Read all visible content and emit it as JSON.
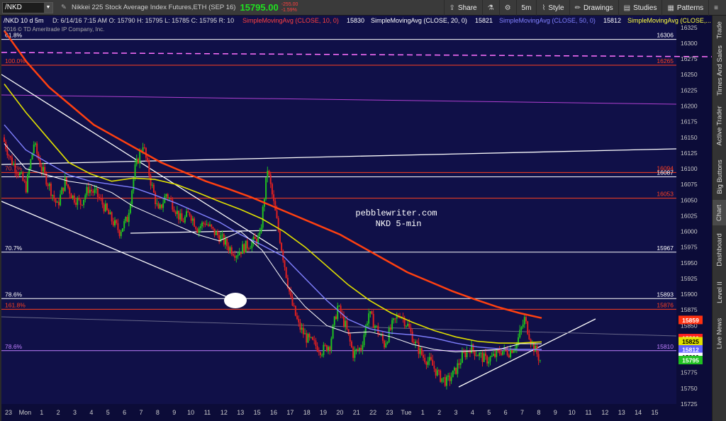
{
  "toolbar": {
    "symbol": "/NKD",
    "instrument": "Nikkei 225 Stock Average Index Futures,ETH (SEP 16)",
    "last": "15795.00",
    "change_abs": "-255.00",
    "change_pct": "-1.59%",
    "buttons": {
      "share": "Share",
      "timeframe": "5m",
      "style": "Style",
      "drawings": "Drawings",
      "studies": "Studies",
      "patterns": "Patterns"
    }
  },
  "chart_header": {
    "symbol_line": "/NKD 10 d 5m",
    "ohlc": "D: 6/14/16 7:15 AM  O: 15790  H: 15795  L: 15785  C: 15795  R: 10",
    "copyright": "2016 © TD Ameritrade IP Company, Inc.",
    "studies": [
      {
        "label": "SimpleMovingAvg (CLOSE, 10, 0)",
        "value": "15830",
        "color": "#ff4040"
      },
      {
        "label": "SimpleMovingAvg (CLOSE, 20, 0)",
        "value": "15821",
        "color": "#ffffff"
      },
      {
        "label": "SimpleMovingAvg (CLOSE, 50, 0)",
        "value": "15812",
        "color": "#8080ff"
      },
      {
        "label": "SimpleMovingAvg (CLOSE,...",
        "value": "",
        "color": "#ffff40"
      }
    ]
  },
  "annotation": {
    "line1": "pebblewriter.com",
    "line2": "NKD 5-min"
  },
  "colors": {
    "background": "#101048",
    "up": "#20c020",
    "down": "#e02020",
    "sma10": "#ff4040",
    "sma20": "#ffffff",
    "sma50": "#8080ff",
    "sma100": "#e0e000",
    "sma200": "#ff4010"
  },
  "side_tabs": [
    "Trade",
    "Times And Sales",
    "Active Trader",
    "Big Buttons",
    "Chart",
    "Dashboard",
    "Level II",
    "Live News"
  ],
  "chart_data": {
    "type": "candlestick",
    "title": "/NKD 10 d 5m",
    "ylim": [
      15725,
      16335
    ],
    "y_ticks": [
      15725,
      15750,
      15775,
      15800,
      15825,
      15850,
      15875,
      15900,
      15925,
      15950,
      15975,
      16000,
      16025,
      16050,
      16075,
      16100,
      16125,
      16150,
      16175,
      16200,
      16225,
      16250,
      16275,
      16300,
      16325
    ],
    "x_ticks": [
      "23",
      "Mon",
      "1",
      "2",
      "3",
      "4",
      "5",
      "6",
      "7",
      "8",
      "9",
      "10",
      "11",
      "12",
      "13",
      "15",
      "16",
      "17",
      "18",
      "19",
      "20",
      "21",
      "22",
      "23",
      "Tue",
      "1",
      "2",
      "3",
      "4",
      "5",
      "6",
      "7",
      "8",
      "9",
      "10",
      "11",
      "12",
      "13",
      "14",
      "15"
    ],
    "fib_levels": [
      {
        "label": "61.8%",
        "value": 16306,
        "color": "#ffffff"
      },
      {
        "label": "100.0%",
        "value": 16265,
        "color": "#ff4020"
      },
      {
        "label": "70.7%",
        "value": 16094,
        "color": "#ff4020"
      },
      {
        "label": "",
        "value": 16087,
        "color": "#ffffff"
      },
      {
        "label": "",
        "value": 16053,
        "color": "#ff4020"
      },
      {
        "label": "70.7%",
        "value": 15967,
        "color": "#ffffff"
      },
      {
        "label": "78.6%",
        "value": 15893,
        "color": "#ffffff"
      },
      {
        "label": "161.8%",
        "value": 15876,
        "color": "#ff4020"
      },
      {
        "label": "78.6%",
        "value": 15810,
        "color": "#c080ff"
      }
    ],
    "price_badges": [
      {
        "value": "15859",
        "color": "#ff3010"
      },
      {
        "value": "15830",
        "color": "#ff2020"
      },
      {
        "value": "15825",
        "color": "#e0e000"
      },
      {
        "value": "15812",
        "color": "#6060ff"
      },
      {
        "value": "15800",
        "color": "#ffffff"
      },
      {
        "value": "15795",
        "color": "#20c020"
      }
    ],
    "price_path": [
      16150,
      16115,
      16095,
      16070,
      16140,
      16100,
      16072,
      16040,
      16080,
      16055,
      16045,
      16068,
      16060,
      16040,
      16018,
      16000,
      16020,
      16100,
      16140,
      16080,
      16030,
      16060,
      16040,
      16015,
      16030,
      16005,
      16015,
      16000,
      15990,
      15975,
      15965,
      15975,
      15982,
      15990,
      16100,
      16030,
      15960,
      15890,
      15850,
      15830,
      15820,
      15810,
      15820,
      15880,
      15850,
      15805,
      15815,
      15870,
      15845,
      15820,
      15850,
      15870,
      15850,
      15820,
      15800,
      15790,
      15770,
      15760,
      15775,
      15800,
      15815,
      15805,
      15795,
      15800,
      15810,
      15808,
      15822,
      15860,
      15820,
      15795
    ],
    "sma_paths": {
      "sma200": [
        16320,
        16270,
        16230,
        16200,
        16170,
        16150,
        16130,
        16110,
        16095,
        16080,
        16068,
        16055,
        16040,
        16025,
        16010,
        15995,
        15975,
        15955,
        15935,
        15920,
        15905,
        15892,
        15880,
        15870,
        15862
      ],
      "sma100": [
        16235,
        16190,
        16150,
        16110,
        16092,
        16080,
        16085,
        16083,
        16075,
        16062,
        16048,
        16035,
        16020,
        16000,
        15975,
        15945,
        15915,
        15890,
        15870,
        15855,
        15842,
        15832,
        15825,
        15822,
        15822,
        15824
      ],
      "sma50": [
        16170,
        16130,
        16110,
        16090,
        16080,
        16075,
        16070,
        16058,
        16045,
        16030,
        16015,
        15995,
        15978,
        15960,
        15925,
        15890,
        15860,
        15845,
        15838,
        15835,
        15830,
        15822,
        15816,
        15813,
        15812,
        15812
      ],
      "sma20": [
        16140,
        16100,
        16090,
        16080,
        16075,
        16062,
        16040,
        16025,
        16010,
        15995,
        15985,
        16000,
        15970,
        15920,
        15880,
        15850,
        15838,
        15840,
        15832,
        15820,
        15812,
        15808,
        15810,
        15812,
        15821,
        15821
      ]
    }
  }
}
